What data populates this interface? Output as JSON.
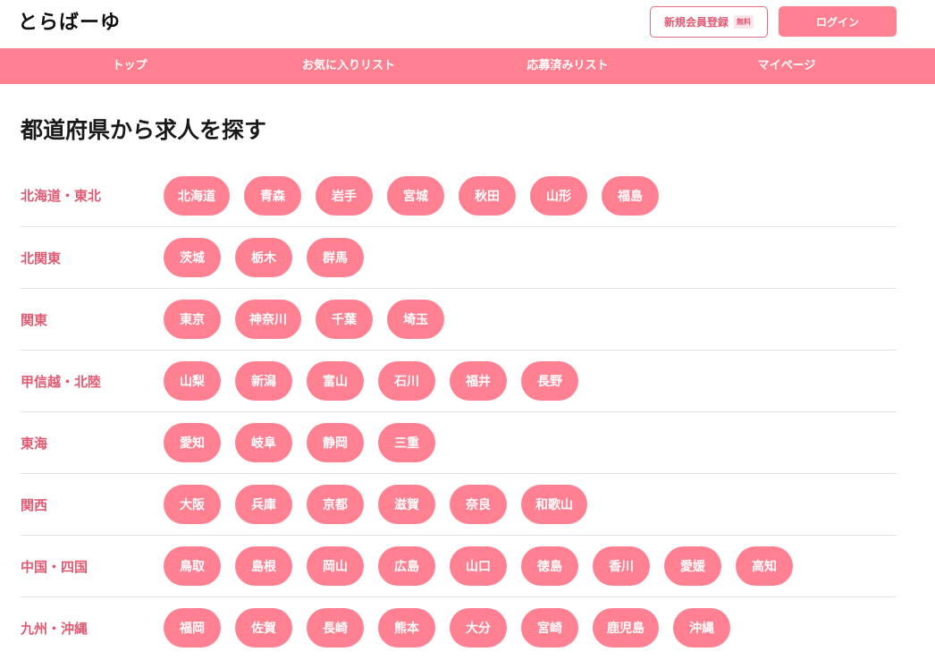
{
  "header": {
    "logo": "とらばーゆ",
    "register_label": "新規会員登録",
    "register_badge": "無料",
    "login_label": "ログイン"
  },
  "nav": {
    "items": [
      "トップ",
      "お気に入りリスト",
      "応募済みリスト",
      "マイページ"
    ]
  },
  "main": {
    "title": "都道府県から求人を探す",
    "regions": [
      {
        "name": "北海道・東北",
        "prefectures": [
          "北海道",
          "青森",
          "岩手",
          "宮城",
          "秋田",
          "山形",
          "福島"
        ]
      },
      {
        "name": "北関東",
        "prefectures": [
          "茨城",
          "栃木",
          "群馬"
        ]
      },
      {
        "name": "関東",
        "prefectures": [
          "東京",
          "神奈川",
          "千葉",
          "埼玉"
        ]
      },
      {
        "name": "甲信越・北陸",
        "prefectures": [
          "山梨",
          "新潟",
          "富山",
          "石川",
          "福井",
          "長野"
        ]
      },
      {
        "name": "東海",
        "prefectures": [
          "愛知",
          "岐阜",
          "静岡",
          "三重"
        ]
      },
      {
        "name": "関西",
        "prefectures": [
          "大阪",
          "兵庫",
          "京都",
          "滋賀",
          "奈良",
          "和歌山"
        ]
      },
      {
        "name": "中国・四国",
        "prefectures": [
          "鳥取",
          "島根",
          "岡山",
          "広島",
          "山口",
          "徳島",
          "香川",
          "愛媛",
          "高知"
        ]
      },
      {
        "name": "九州・沖縄",
        "prefectures": [
          "福岡",
          "佐賀",
          "長崎",
          "熊本",
          "大分",
          "宮崎",
          "鹿児島",
          "沖縄"
        ]
      }
    ]
  },
  "colors": {
    "accent": "#ff8191",
    "region_text": "#e05a72"
  }
}
